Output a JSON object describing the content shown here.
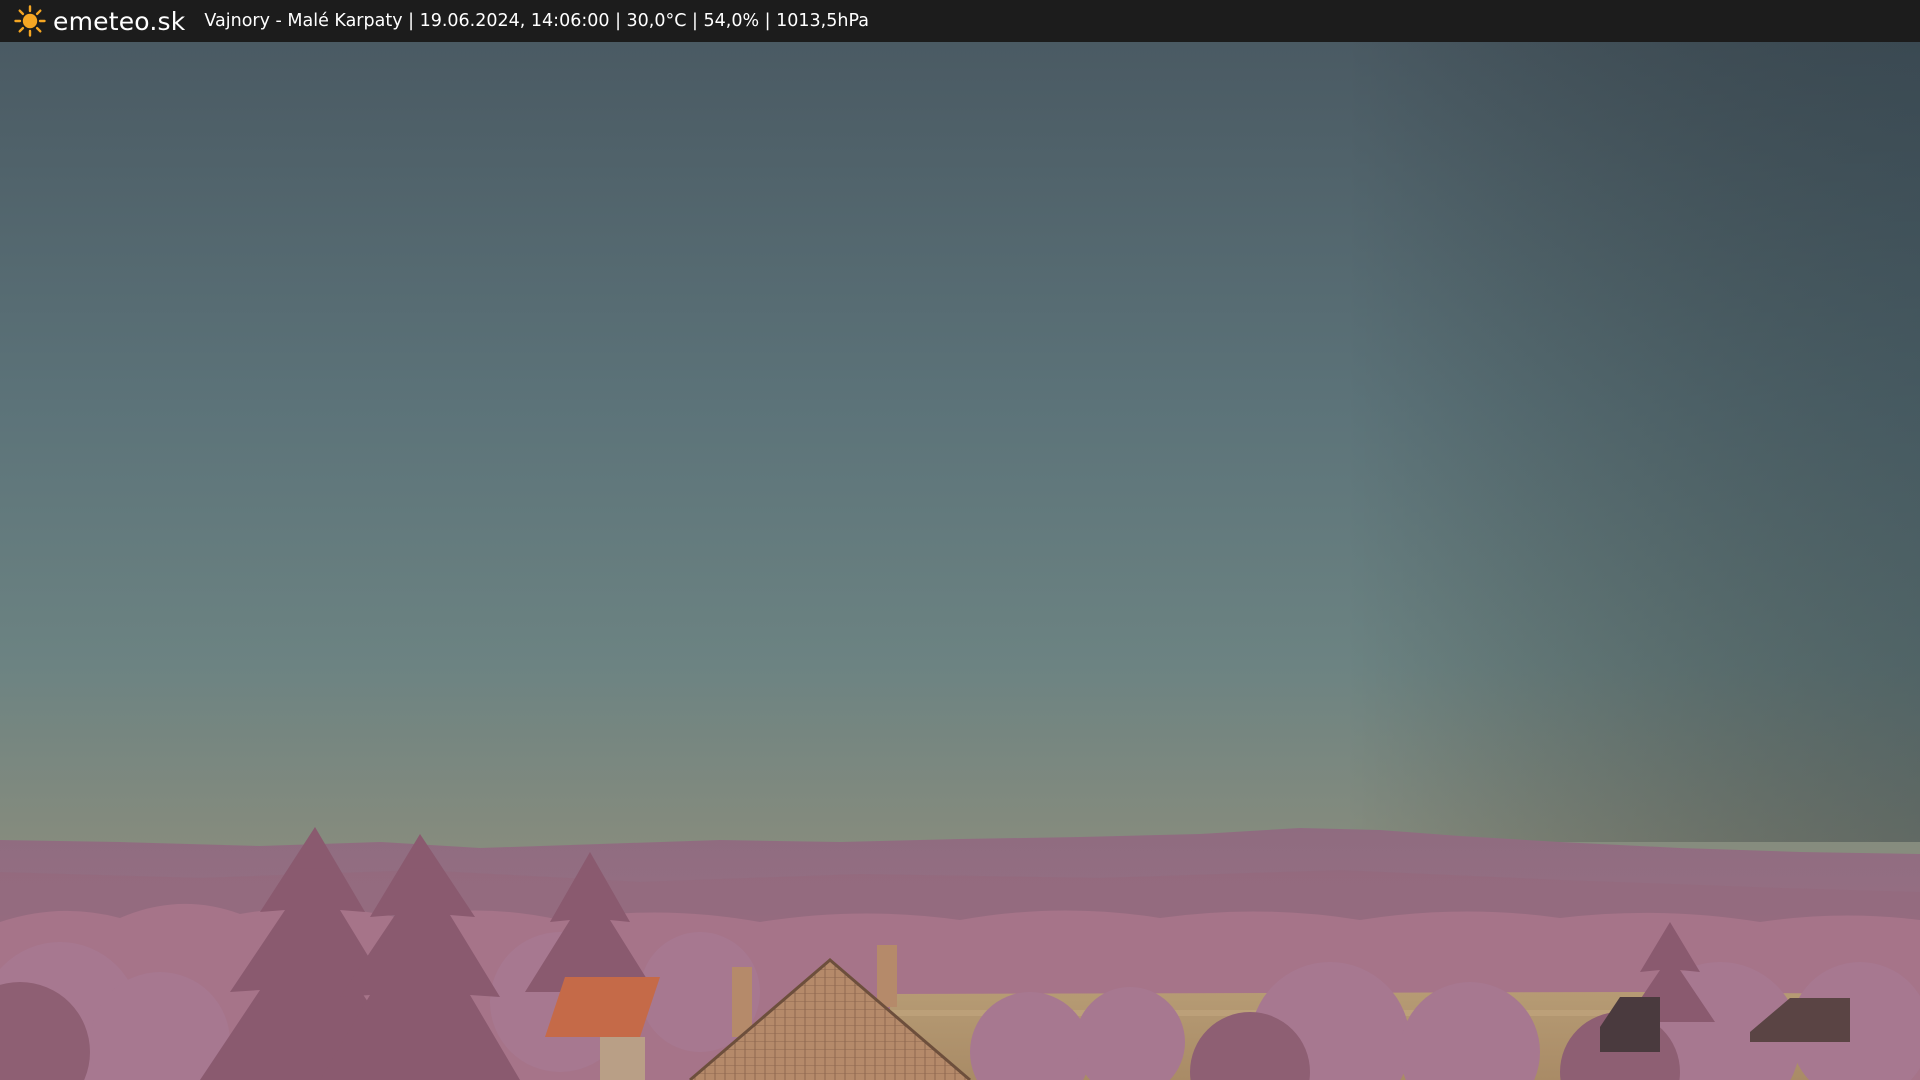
{
  "header": {
    "logo_icon": "sun-icon",
    "brand": "emeteo.sk",
    "location": "Vajnory - Malé Karpaty",
    "datetime": "19.06.2024, 14:06:00",
    "temperature": "30,0°C",
    "humidity": "54,0%",
    "pressure": "1013,5hPa",
    "separator": " | "
  },
  "colors": {
    "bar": "#1c1c1c",
    "sun": "#f5a623",
    "sky_top": "#4a5a63",
    "sky_mid": "#637a80",
    "sky_horizon": "#92917a",
    "hills": "#9a6e83",
    "foliage": "#a87a90",
    "field": "#b89a70",
    "roof": "#c06a48"
  }
}
